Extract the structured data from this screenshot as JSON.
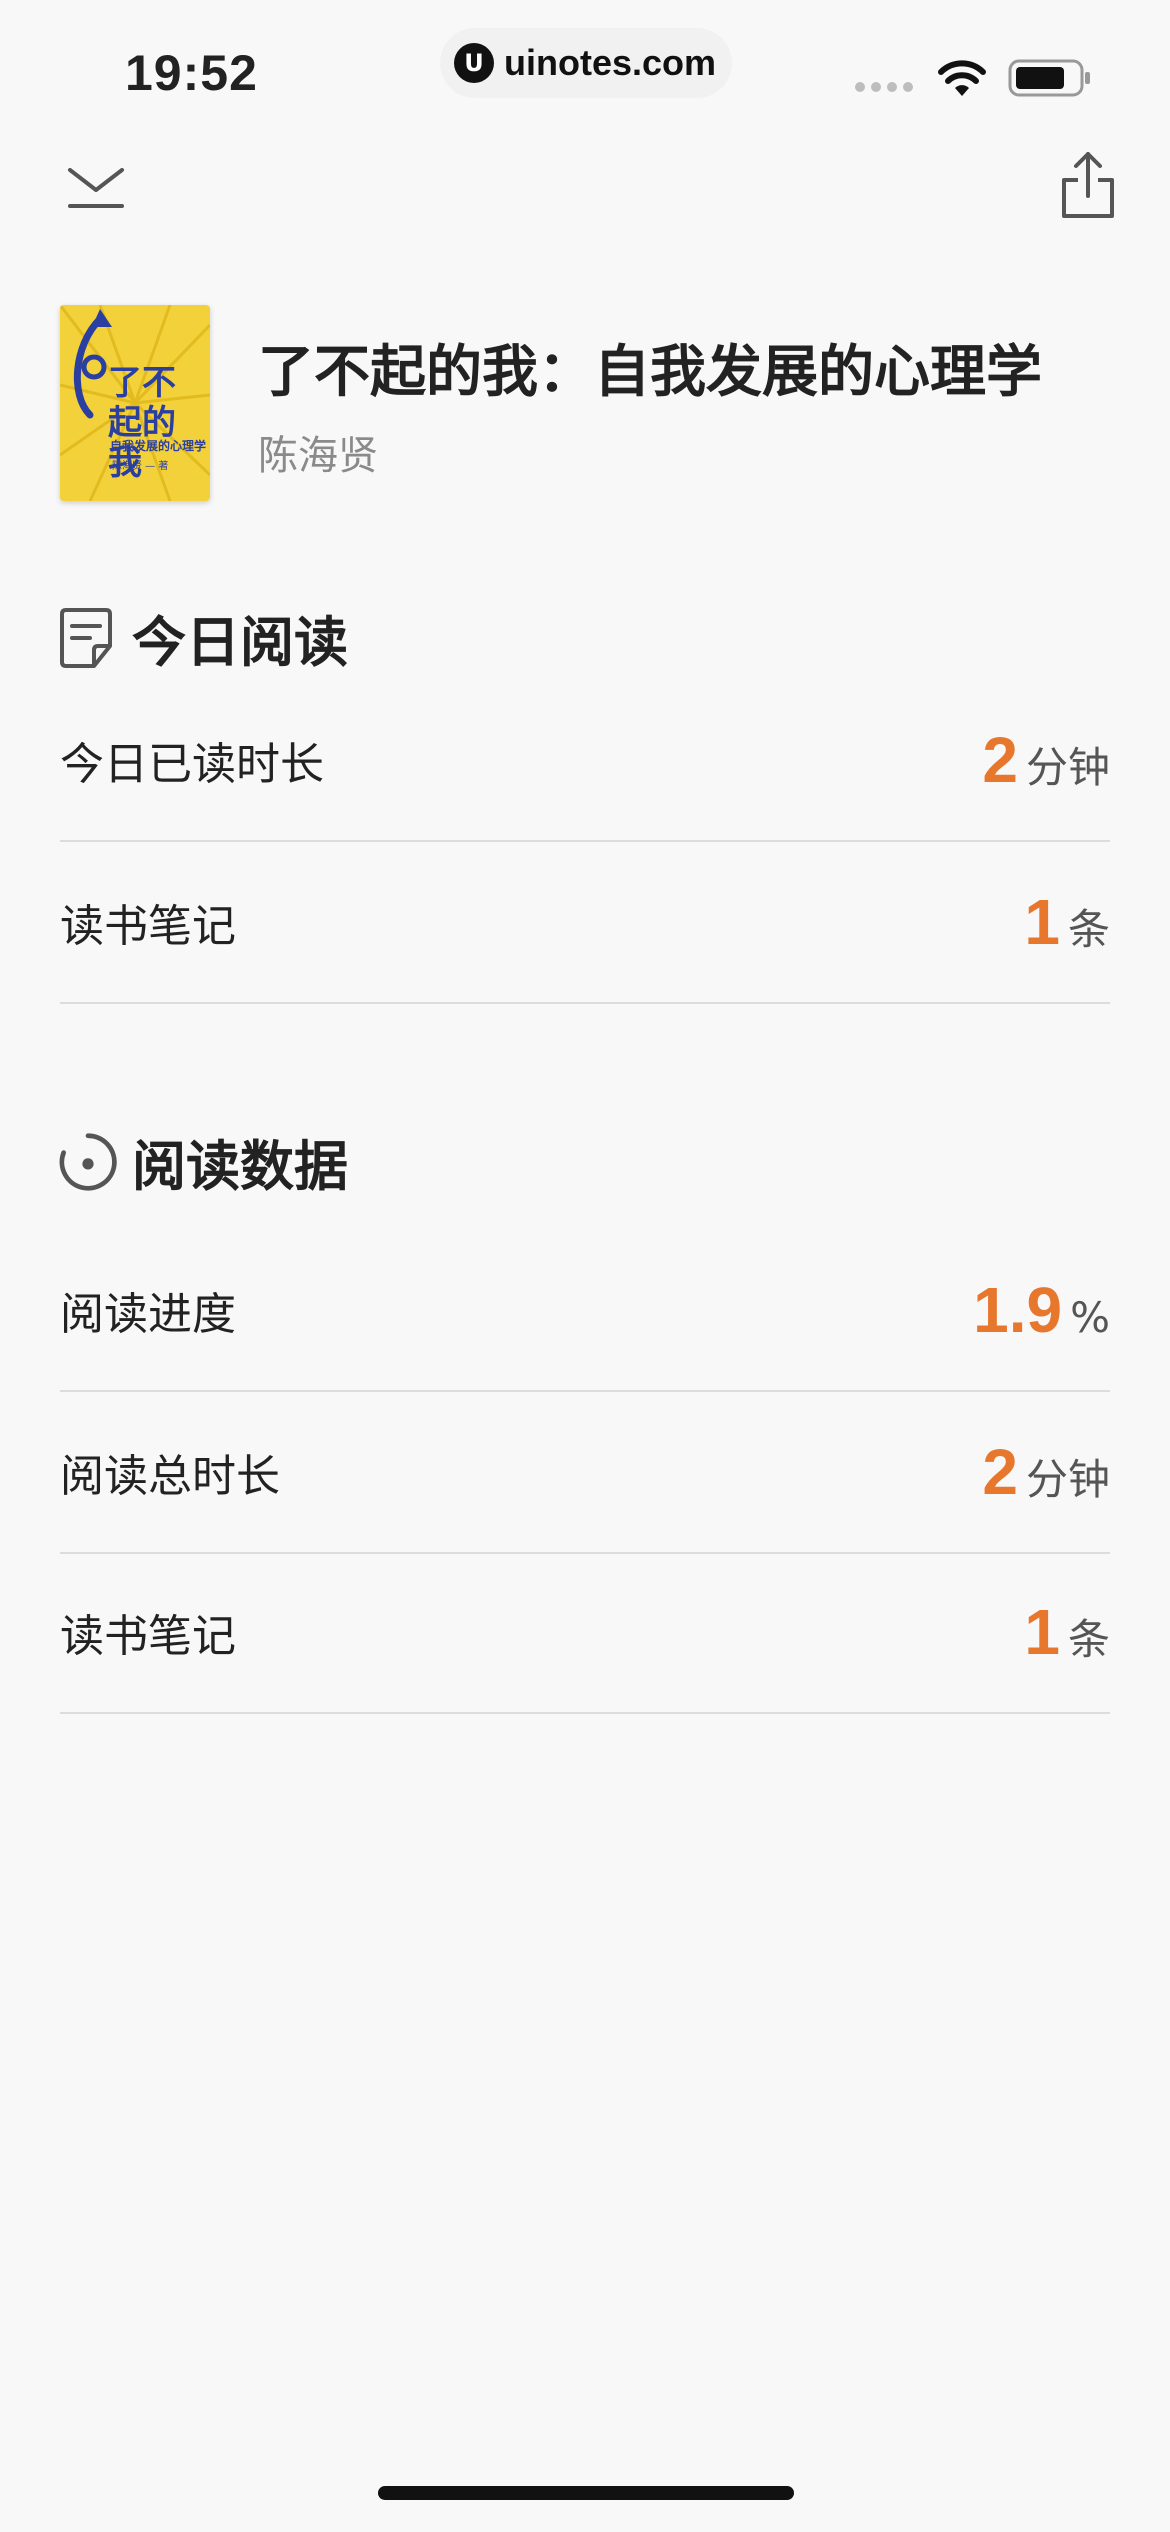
{
  "status_bar": {
    "time": "19:52",
    "watermark": "uinotes.com"
  },
  "book": {
    "cover_title": "了不起的我",
    "cover_subtitle": "自我发展的心理学",
    "cover_author": "陈海贤 — 著",
    "title": "了不起的我：自我发展的心理学",
    "author": "陈海贤"
  },
  "today": {
    "heading": "今日阅读",
    "rows": [
      {
        "label": "今日已读时长",
        "value": "2",
        "unit": "分钟"
      },
      {
        "label": "读书笔记",
        "value": "1",
        "unit": "条"
      }
    ]
  },
  "stats": {
    "heading": "阅读数据",
    "rows": [
      {
        "label": "阅读进度",
        "value": "1.9",
        "unit": "%"
      },
      {
        "label": "阅读总时长",
        "value": "2",
        "unit": "分钟"
      },
      {
        "label": "读书笔记",
        "value": "1",
        "unit": "条"
      }
    ]
  },
  "colors": {
    "accent": "#e8772e",
    "background": "#f8f8f8",
    "divider": "#dcdcdc",
    "cover_yellow": "#f3d13a",
    "cover_blue": "#2a3fa0"
  },
  "icons": [
    "collapse-icon",
    "share-icon",
    "note-icon",
    "progress-ring-icon",
    "wifi-icon",
    "battery-icon"
  ]
}
